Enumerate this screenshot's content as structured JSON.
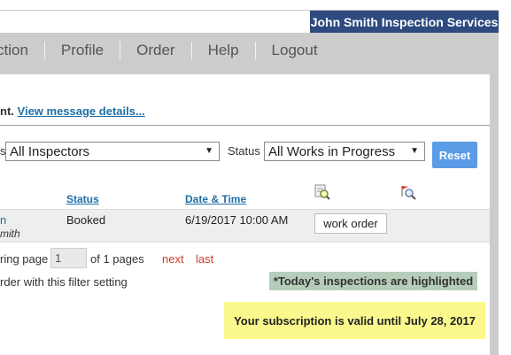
{
  "header": {
    "company": "John Smith Inspection Services"
  },
  "nav": {
    "items": [
      {
        "label": "ction"
      },
      {
        "label": "Profile"
      },
      {
        "label": "Order"
      },
      {
        "label": "Help"
      },
      {
        "label": "Logout"
      }
    ]
  },
  "message": {
    "prefix": "nt.",
    "link": "View message details..."
  },
  "filters": {
    "inspector_label_fragment": "s",
    "inspector_value": "All Inspectors",
    "status_label": "Status",
    "status_value": "All Works in Progress",
    "reset_label": "Reset"
  },
  "table": {
    "headers": {
      "status": "Status",
      "datetime": "Date & Time"
    },
    "icons": {
      "header_icon_1": "magnifier-document-icon",
      "header_icon_2": "magnifier-flag-icon"
    },
    "rows": [
      {
        "client_line1": "n",
        "client_line2": "mith",
        "status": "Booked",
        "datetime": "6/19/2017 10:00 AM",
        "action": "work order"
      }
    ]
  },
  "pagination": {
    "prefix": "ring page",
    "current": "1",
    "suffix": "of 1 pages",
    "next": "next",
    "last": "last"
  },
  "footer": {
    "note": "rder with this filter setting",
    "today_badge": "*Today's inspections are highlighted",
    "subscription": "Your subscription is valid until July 28, 2017"
  },
  "colors": {
    "brand": "#2e4a7f",
    "link": "#1f6fa6",
    "reset": "#5b9ce6",
    "pager": "#d23a2f",
    "today_highlight": "#b5cdb9",
    "subscription_highlight": "#fbf98d"
  }
}
